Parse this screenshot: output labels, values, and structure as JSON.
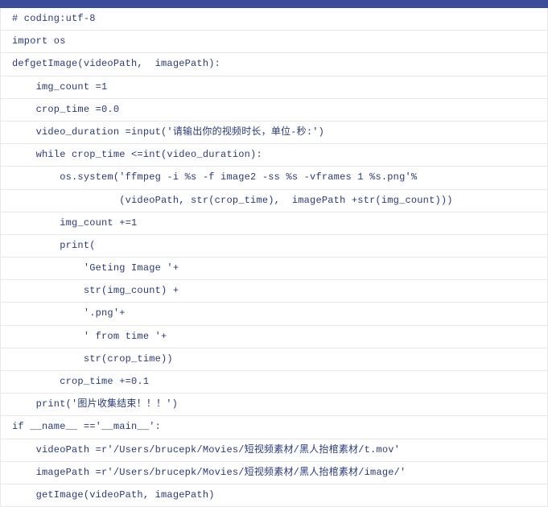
{
  "code": {
    "lines": [
      "# coding:utf-8",
      "import os",
      "defgetImage(videoPath,  imagePath):",
      "    img_count =1",
      "    crop_time =0.0",
      "    video_duration =input('请输出你的视频时长，单位-秒:')",
      "    while crop_time <=int(video_duration):",
      "        os.system('ffmpeg -i %s -f image2 -ss %s -vframes 1 %s.png'%",
      "                  (videoPath, str(crop_time),  imagePath +str(img_count)))",
      "        img_count +=1",
      "        print(",
      "            'Geting Image '+",
      "            str(img_count) +",
      "            '.png'+",
      "            ' from time '+",
      "            str(crop_time))",
      "        crop_time +=0.1",
      "    print('图片收集结束！！！')",
      "if __name__ =='__main__':",
      "    videoPath =r'/Users/brucepk/Movies/短视频素材/黑人抬棺素材/t.mov'",
      "    imagePath =r'/Users/brucepk/Movies/短视频素材/黑人抬棺素材/image/'",
      "    getImage(videoPath, imagePath)"
    ]
  }
}
